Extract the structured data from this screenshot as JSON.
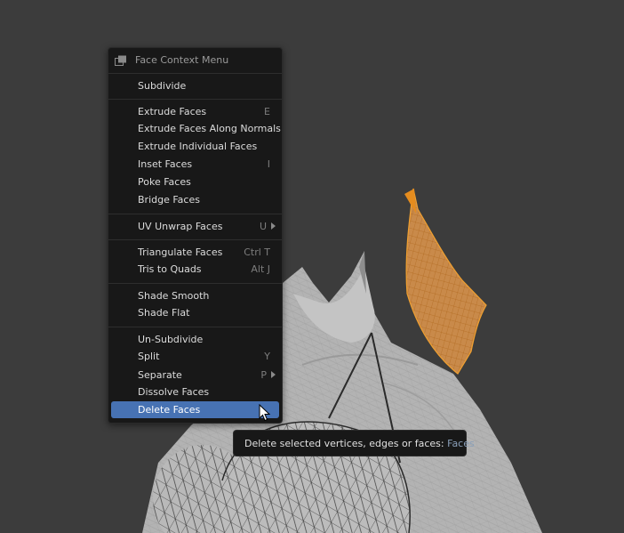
{
  "menu": {
    "title": "Face Context Menu",
    "icon": "face-select-icon",
    "items": [
      {
        "label": "Subdivide",
        "shortcut": ""
      },
      {
        "label": "Extrude Faces",
        "shortcut": "E"
      },
      {
        "label": "Extrude Faces Along Normals",
        "shortcut": ""
      },
      {
        "label": "Extrude Individual Faces",
        "shortcut": ""
      },
      {
        "label": "Inset Faces",
        "shortcut": "I"
      },
      {
        "label": "Poke Faces",
        "shortcut": ""
      },
      {
        "label": "Bridge Faces",
        "shortcut": ""
      },
      {
        "label": "UV Unwrap Faces",
        "shortcut": "U"
      },
      {
        "label": "Triangulate Faces",
        "shortcut": "Ctrl T"
      },
      {
        "label": "Tris to Quads",
        "shortcut": "Alt J"
      },
      {
        "label": "Shade Smooth",
        "shortcut": ""
      },
      {
        "label": "Shade Flat",
        "shortcut": ""
      },
      {
        "label": "Un-Subdivide",
        "shortcut": ""
      },
      {
        "label": "Split",
        "shortcut": "Y"
      },
      {
        "label": "Separate",
        "shortcut": "P"
      },
      {
        "label": "Dissolve Faces",
        "shortcut": ""
      },
      {
        "label": "Delete Faces",
        "shortcut": ""
      }
    ]
  },
  "tooltip": {
    "text": "Delete selected vertices, edges or faces: ",
    "value": "Faces"
  },
  "colors": {
    "background": "#3c3c3c",
    "menu_bg": "#181818",
    "highlight": "#4772b3",
    "selection_orange": "#e8902a",
    "mesh_gray": "#b0b0b0"
  }
}
